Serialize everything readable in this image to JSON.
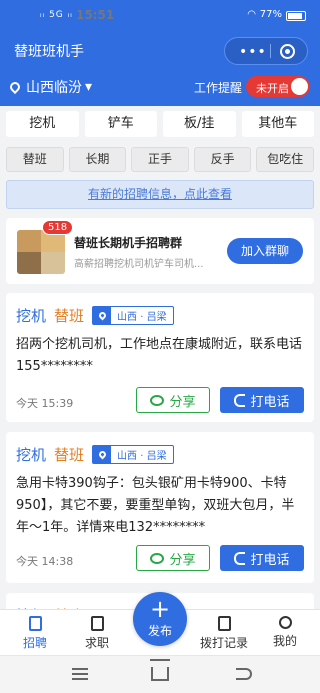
{
  "status": {
    "signal": "ᵢᵢ 5G ᵢᵢ",
    "time": "15:51",
    "battery": "77%"
  },
  "header": {
    "title": "替班班机手",
    "capsule_dots": "•••"
  },
  "location": {
    "city": "山西临汾",
    "caret": "▾",
    "remind_label": "工作提醒",
    "toggle_label": "未开启"
  },
  "categories": [
    "挖机",
    "铲车",
    "板/挂",
    "其他车"
  ],
  "subcategories": [
    "替班",
    "长期",
    "正手",
    "反手",
    "包吃住"
  ],
  "notice": "有新的招聘信息，点此查看",
  "group": {
    "badge": "518",
    "title": "替班长期机手招聘群",
    "desc": "高薪招聘挖机司机铲车司机...",
    "join_label": "加入群聊"
  },
  "jobs": [
    {
      "type": "挖机",
      "kind": "替班",
      "location": "山西 · 吕梁",
      "desc": "招两个挖机司机，工作地点在康城附近，联系电话155********",
      "time": "今天 15:39",
      "share_label": "分享",
      "call_label": "打电话"
    },
    {
      "type": "挖机",
      "kind": "替班",
      "location": "山西 · 吕梁",
      "desc": "急用卡特390钩子：包头银矿用卡特900、卡特950】，其它不要，要重型单钩，双班大包月，半年～1年。详情来电132********",
      "time": "今天 14:38",
      "share_label": "分享",
      "call_label": "打电话"
    },
    {
      "type": "挖机",
      "kind": "替班"
    }
  ],
  "tabs": {
    "recruit": "招聘",
    "job": "求职",
    "publish": "发布",
    "publish_plus": "+",
    "calls": "拨打记录",
    "mine": "我的"
  },
  "colors": {
    "primary": "#2f6de1",
    "accent": "#e67e22",
    "share_green": "#28a745",
    "alert_red": "#e53935"
  }
}
